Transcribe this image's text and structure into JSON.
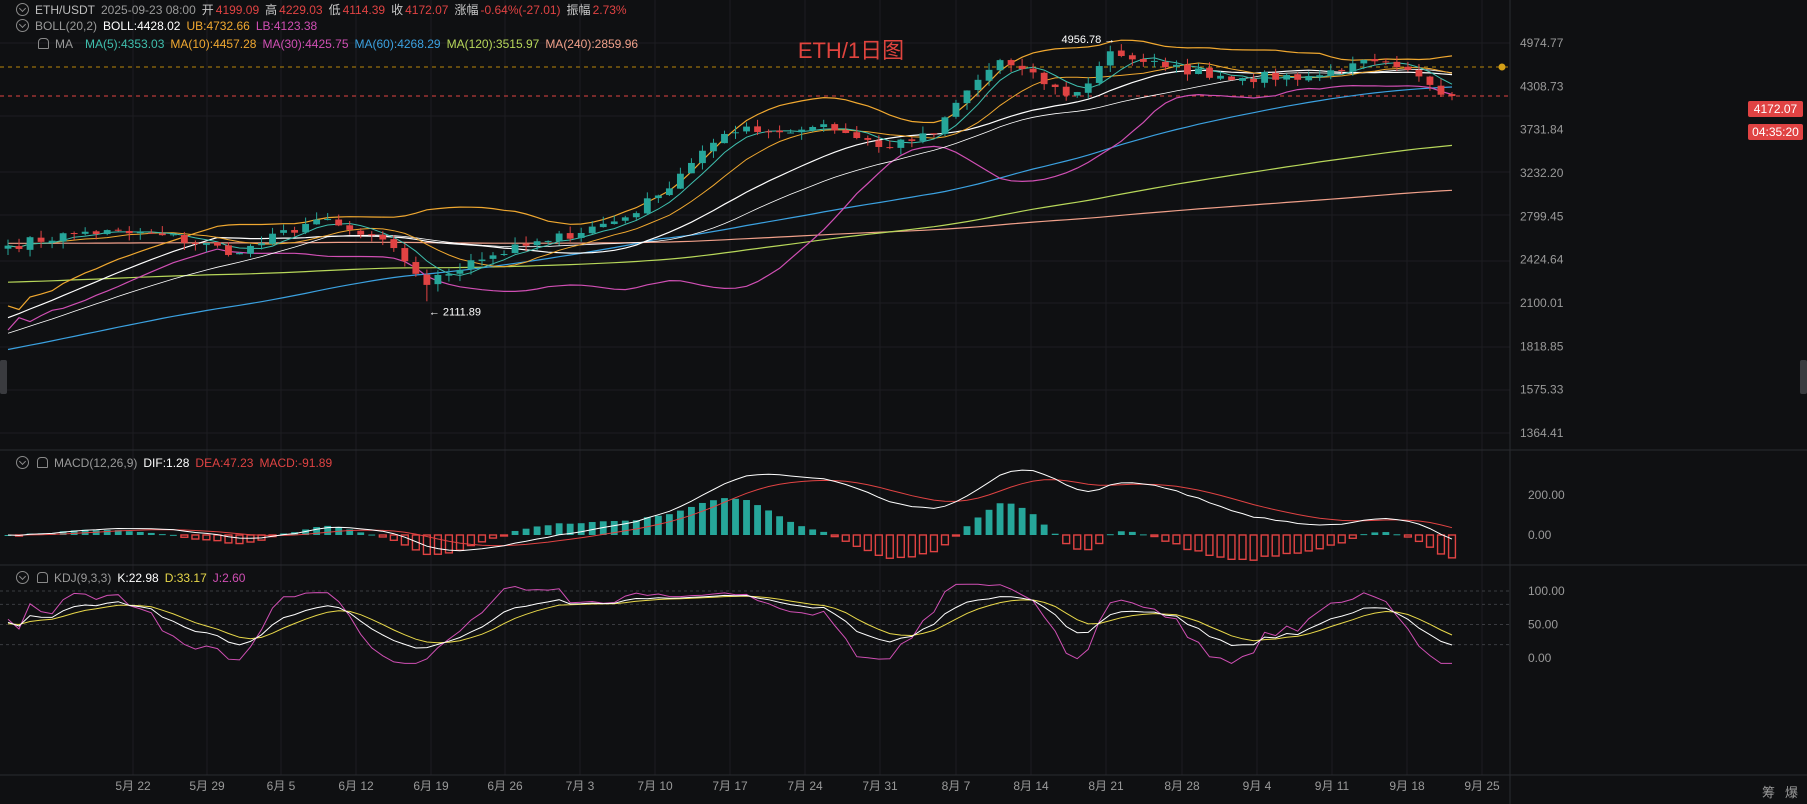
{
  "watermark": "ETH/1日图",
  "header": {
    "symbol": "ETH/USDT",
    "datetime": "2025-09-23 08:00",
    "open_label": "开",
    "open": "4199.09",
    "high_label": "高",
    "high": "4229.03",
    "low_label": "低",
    "low": "4114.39",
    "close_label": "收",
    "close": "4172.07",
    "change_label": "涨幅",
    "change": "-0.64%(-27.01)",
    "amp_label": "振幅",
    "amp": "2.73%"
  },
  "boll": {
    "name": "BOLL(20,2)",
    "mid": "BOLL:4428.02",
    "ub": "UB:4732.66",
    "lb": "LB:4123.38"
  },
  "ma": {
    "name": "MA",
    "items": [
      {
        "text": "MA(5):4353.03",
        "color": "#3fbfae"
      },
      {
        "text": "MA(10):4457.28",
        "color": "#f0a830"
      },
      {
        "text": "MA(30):4425.75",
        "color": "#d04fb4"
      },
      {
        "text": "MA(60):4268.29",
        "color": "#3ba1e0"
      },
      {
        "text": "MA(120):3515.97",
        "color": "#b7d75a"
      },
      {
        "text": "MA(240):2859.96",
        "color": "#f0a08a"
      }
    ]
  },
  "macd": {
    "name": "MACD(12,26,9)",
    "dif": "DIF:1.28",
    "dea": "DEA:47.23",
    "macd": "MACD:-91.89"
  },
  "kdj": {
    "name": "KDJ(9,3,3)",
    "k": "K:22.98",
    "d": "D:33.17",
    "j": "J:2.60"
  },
  "price_tag": "4172.07",
  "countdown": "04:35:20",
  "max_label": "4956.78",
  "min_label": "2111.89",
  "y_ticks": [
    "4974.77",
    "4308.73",
    "3731.84",
    "3232.20",
    "2799.45",
    "2424.64",
    "2100.01",
    "1818.85",
    "1575.33",
    "1364.41"
  ],
  "macd_ticks": [
    "200.00",
    "0.00"
  ],
  "kdj_ticks": [
    "100.00",
    "50.00",
    "0.00"
  ],
  "x_ticks": [
    "5月 22",
    "5月 29",
    "6月 5",
    "6月 12",
    "6月 19",
    "6月 26",
    "7月 3",
    "7月 10",
    "7月 17",
    "7月 24",
    "7月 31",
    "8月 7",
    "8月 14",
    "8月 21",
    "8月 28",
    "9月 4",
    "9月 11",
    "9月 18",
    "9月 25"
  ],
  "corner_icons": [
    "筹",
    "爆"
  ],
  "colors": {
    "up": "#26a69a",
    "down": "#e04343",
    "bg": "#0f1012"
  },
  "chart_data": {
    "type": "candlestick",
    "title": "ETH/1日图",
    "start_date": "2025-05-15",
    "end_date": "2025-09-23",
    "ohlc_step_days": 1,
    "close_anchors": [
      [
        "05-15",
        2540
      ],
      [
        "05-22",
        2660
      ],
      [
        "05-29",
        2630
      ],
      [
        "06-05",
        2480
      ],
      [
        "06-12",
        2770
      ],
      [
        "06-19",
        2520
      ],
      [
        "06-22",
        2230
      ],
      [
        "06-26",
        2420
      ],
      [
        "07-03",
        2580
      ],
      [
        "07-10",
        2790
      ],
      [
        "07-13",
        3000
      ],
      [
        "07-17",
        3480
      ],
      [
        "07-21",
        3770
      ],
      [
        "07-24",
        3700
      ],
      [
        "07-28",
        3800
      ],
      [
        "07-31",
        3630
      ],
      [
        "08-03",
        3520
      ],
      [
        "08-07",
        3680
      ],
      [
        "08-10",
        4250
      ],
      [
        "08-13",
        4700
      ],
      [
        "08-14",
        4620
      ],
      [
        "08-19",
        4180
      ],
      [
        "08-21",
        4350
      ],
      [
        "08-23",
        4840
      ],
      [
        "08-28",
        4590
      ],
      [
        "09-04",
        4430
      ],
      [
        "09-11",
        4470
      ],
      [
        "09-14",
        4650
      ],
      [
        "09-18",
        4590
      ],
      [
        "09-22",
        4190
      ],
      [
        "09-23",
        4172.07
      ]
    ],
    "marked_high": 4956.78,
    "marked_low": 2111.89,
    "ylim": [
      1300,
      5050
    ],
    "y_scale": "log",
    "macd_ylim": [
      -140,
      290
    ],
    "kdj_ylim": [
      -10,
      112
    ],
    "last": {
      "open": 4199.09,
      "high": 4229.03,
      "low": 4114.39,
      "close": 4172.07
    },
    "overlays": [
      "MA(5)",
      "MA(10)",
      "MA(30)",
      "MA(60)",
      "MA(120)",
      "MA(240)",
      "BOLL(20,2)"
    ]
  }
}
